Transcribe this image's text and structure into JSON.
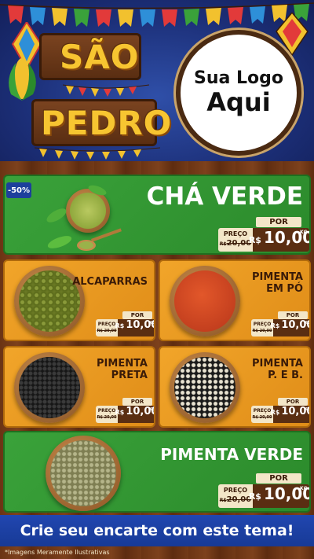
{
  "header": {
    "sign_line1": "SÃO",
    "sign_line2": "PEDRO",
    "logo_line1": "Sua Logo",
    "logo_line2": "Aqui"
  },
  "featured_top": {
    "badge": "-50%",
    "name": "CHÁ VERDE",
    "por_label": "POR",
    "preco_label": "PREÇO",
    "old_prefix": "R$",
    "old_price": "20,00",
    "new_currency": "R$",
    "new_price": "10,00",
    "unit": "KG"
  },
  "grid_items": [
    {
      "name_line1": "ALCAPARRAS",
      "name_line2": "",
      "por_label": "POR",
      "preco_label": "PREÇO",
      "old_price": "R$ 20,00",
      "new_currency": "R$",
      "new_price": "10,00",
      "unit": "KG"
    },
    {
      "name_line1": "PIMENTA",
      "name_line2": "EM PÓ",
      "por_label": "POR",
      "preco_label": "PREÇO",
      "old_price": "R$ 20,00",
      "new_currency": "R$",
      "new_price": "10,00",
      "unit": "KG"
    },
    {
      "name_line1": "PIMENTA",
      "name_line2": "PRETA",
      "por_label": "POR",
      "preco_label": "PREÇO",
      "old_price": "R$ 20,00",
      "new_currency": "R$",
      "new_price": "10,00",
      "unit": "KG"
    },
    {
      "name_line1": "PIMENTA",
      "name_line2": "P. E B.",
      "por_label": "POR",
      "preco_label": "PREÇO",
      "old_price": "R$ 20,00",
      "new_currency": "R$",
      "new_price": "10,00",
      "unit": "KG"
    }
  ],
  "featured_bottom": {
    "name": "PIMENTA VERDE",
    "por_label": "POR",
    "preco_label": "PREÇO",
    "old_prefix": "R$",
    "old_price": "20,00",
    "new_currency": "R$",
    "new_price": "10,00",
    "unit": "KG"
  },
  "footer": {
    "cta": "Crie seu encarte com este tema!",
    "disclaimer": "*Imagens Meramente Ilustrativas"
  },
  "colors": {
    "green": "#2f962f",
    "orange": "#ec9b22",
    "wood": "#6b3414",
    "blue": "#1d3f9c",
    "sign_yellow": "#f7c531"
  }
}
